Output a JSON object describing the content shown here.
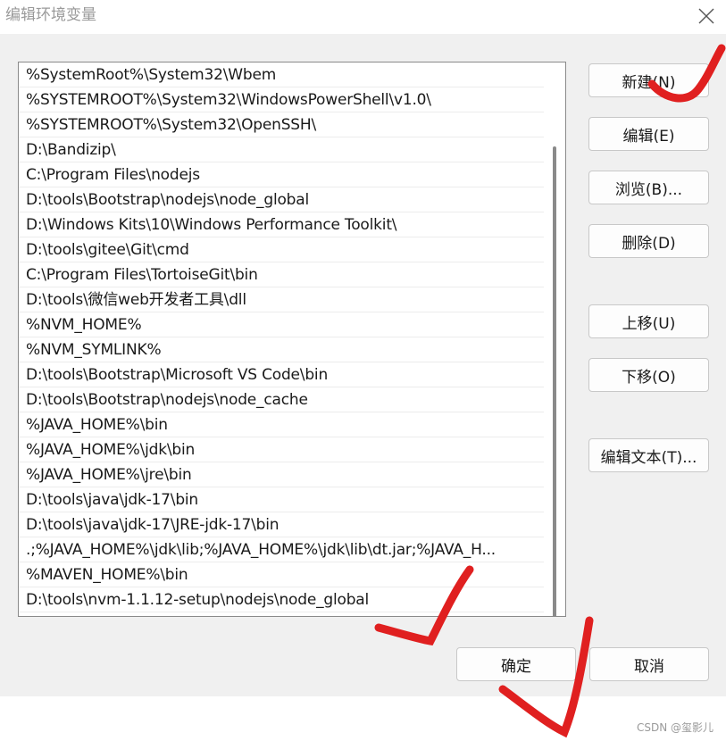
{
  "window": {
    "title": "编辑环境变量",
    "close_icon": "close-icon"
  },
  "path_list": {
    "entries": [
      "%SystemRoot%\\System32\\Wbem",
      "%SYSTEMROOT%\\System32\\WindowsPowerShell\\v1.0\\",
      "%SYSTEMROOT%\\System32\\OpenSSH\\",
      "D:\\Bandizip\\",
      "C:\\Program Files\\nodejs",
      "D:\\tools\\Bootstrap\\nodejs\\node_global",
      "D:\\Windows Kits\\10\\Windows Performance Toolkit\\",
      "D:\\tools\\gitee\\Git\\cmd",
      "C:\\Program Files\\TortoiseGit\\bin",
      "D:\\tools\\微信web开发者工具\\dll",
      "%NVM_HOME%",
      "%NVM_SYMLINK%",
      "D:\\tools\\Bootstrap\\Microsoft VS Code\\bin",
      "D:\\tools\\Bootstrap\\nodejs\\node_cache",
      "%JAVA_HOME%\\bin",
      "%JAVA_HOME%\\jdk\\bin",
      "%JAVA_HOME%\\jre\\bin",
      "D:\\tools\\java\\jdk-17\\bin",
      "D:\\tools\\java\\jdk-17\\JRE-jdk-17\\bin",
      ".;%JAVA_HOME%\\jdk\\lib;%JAVA_HOME%\\jdk\\lib\\dt.jar;%JAVA_H...",
      "%MAVEN_HOME%\\bin",
      "D:\\tools\\nvm-1.1.12-setup\\nodejs\\node_global"
    ]
  },
  "buttons": {
    "new": "新建(N)",
    "edit": "编辑(E)",
    "browse": "浏览(B)...",
    "delete": "删除(D)",
    "move_up": "上移(U)",
    "move_down": "下移(O)",
    "edit_text": "编辑文本(T)...",
    "ok": "确定",
    "cancel": "取消"
  },
  "watermark": "CSDN @玺影儿",
  "annotation_color": "#e02020"
}
